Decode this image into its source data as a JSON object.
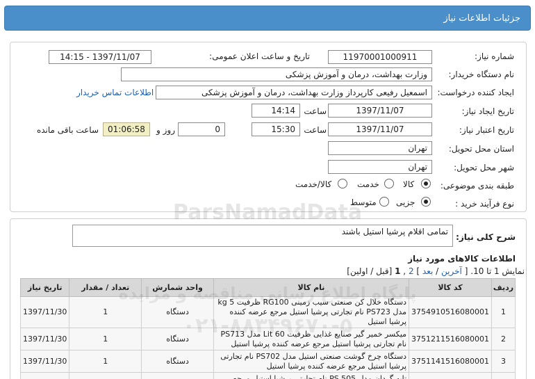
{
  "header": {
    "title": "جزئیات اطلاعات نیاز"
  },
  "form": {
    "need_number_label": "شماره نیاز:",
    "need_number": "11970001000911",
    "announce_label": "تاریخ و ساعت اعلان عمومی:",
    "announce_value": "1397/11/07 - 14:15",
    "buyer_label": "نام دستگاه خریدار:",
    "buyer_value": "وزارت بهداشت، درمان و آموزش پزشکی",
    "creator_label": "ایجاد کننده درخواست:",
    "creator_value": "اسمعیل رفیعی کارپرداز وزارت بهداشت، درمان و آموزش پزشکی",
    "contact_link": "اطلاعات تماس خریدار",
    "create_date_label": "تاریخ ایجاد نیاز:",
    "create_date": "1397/11/07",
    "time_label": "ساعت",
    "create_time": "14:14",
    "validity_label": "تاریخ اعتبار نیاز:",
    "validity_date": "1397/11/07",
    "validity_time": "15:30",
    "days_value": "0",
    "days_label": "روز و",
    "remaining_time": "01:06:58",
    "remaining_label": "ساعت باقی مانده",
    "province_label": "استان محل تحویل:",
    "province_value": "تهران",
    "city_label": "شهر محل تحویل:",
    "city_value": "تهران",
    "category_label": "طبقه بندی موضوعی:",
    "category_options": [
      "کالا",
      "خدمت",
      "کالا/خدمت"
    ],
    "process_label": "نوع فرآیند خرید :",
    "process_options": [
      "جزیی",
      "متوسط"
    ]
  },
  "description": {
    "label": "شرح کلی نیاز:",
    "value": "تمامی اقلام پرشیا استیل باشند"
  },
  "items_section": {
    "title": "اطلاعات کالاهای مورد نیاز",
    "pager_prefix": "نمایش 1 تا 10.",
    "pager_last": "آخرین",
    "pager_next": "بعد",
    "pager_pages": "2",
    "pager_current": "1",
    "pager_tail": "[قبل / اولین]",
    "columns": [
      "ردیف",
      "کد کالا",
      "نام کالا",
      "واحد شمارش",
      "تعداد / مقدار",
      "تاریخ نیاز"
    ],
    "rows": [
      {
        "row": "1",
        "code": "3754910516080001",
        "name": "دستگاه خلال کن صنعتی سیب زمینی RG100 ظرفیت kg 5 مدل PS723 نام تجارتی پرشیا استیل مرجع عرضه کننده پرشیا استیل",
        "unit": "دستگاه",
        "qty": "1",
        "date": "1397/11/30"
      },
      {
        "row": "2",
        "code": "3751211516080001",
        "name": "میکسر خمیر گیر صنایع غذایی ظرفیت Lit 60 مدل PS713 نام تجارتی پرشیا استیل مرجع عرضه کننده پرشیا استیل",
        "unit": "دستگاه",
        "qty": "1",
        "date": "1397/11/30"
      },
      {
        "row": "3",
        "code": "3751141516080001",
        "name": "دستگاه چرخ گوشت صنعتی استیل مدل PS702 نام تجارتی پرشیا استیل مرجع عرضه کننده پرشیا استیل",
        "unit": "دستگاه",
        "qty": "1",
        "date": "1397/11/30"
      },
      {
        "row": "4",
        "code": "3752532516080001",
        "name": "تابه گردان مدل PS 505 نام تجارتی پرشیا استیل مرجع عرضه",
        "unit": "دستگاه",
        "qty": "1",
        "date": "1397/11/30"
      }
    ]
  },
  "watermark": {
    "brand": "ParsNamadData",
    "line1": "پایگاه اطلاع رسانی مناقصه و مزایده",
    "phone": "۰۲۱-۸۸۳۴۹۶۷۰-۵"
  },
  "colors": {
    "header_bg": "#4a8fc9",
    "link": "#1a5fb4",
    "remaining_bg": "#f3efc5"
  }
}
